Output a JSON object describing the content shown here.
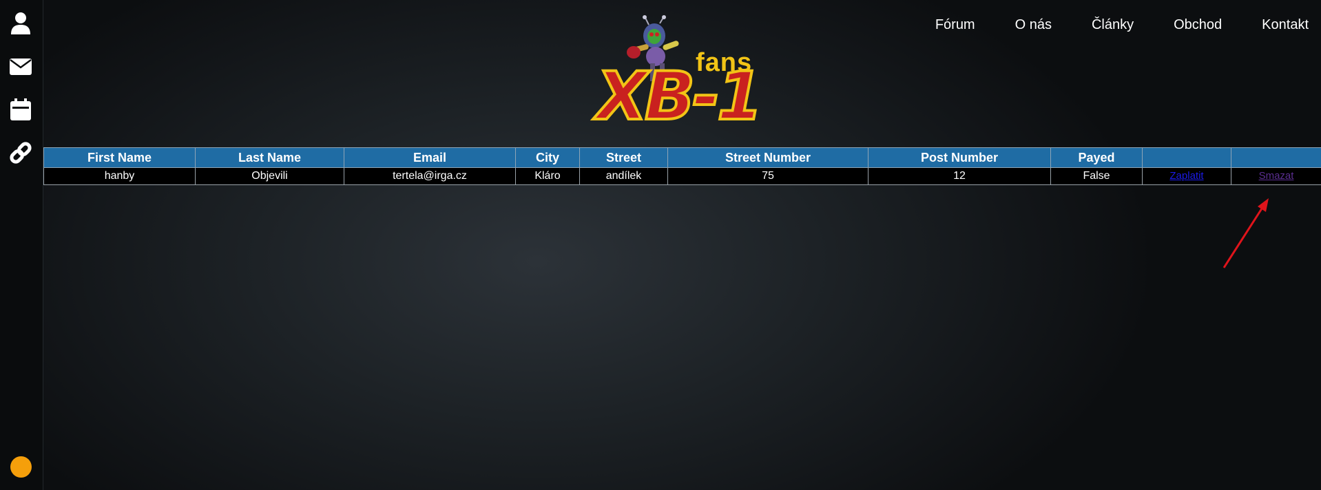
{
  "sidebar": {
    "items": [
      {
        "icon": "user-icon"
      },
      {
        "icon": "envelope-icon"
      },
      {
        "icon": "calendar-icon"
      },
      {
        "icon": "link-icon"
      }
    ],
    "status_color": "#f59f0b"
  },
  "logo": {
    "fans": "fans",
    "name": "XB-1"
  },
  "nav": {
    "items": [
      "Fórum",
      "O nás",
      "Články",
      "Obchod",
      "Kontakt"
    ]
  },
  "table": {
    "headers": [
      "First Name",
      "Last Name",
      "Email",
      "City",
      "Street",
      "Street Number",
      "Post Number",
      "Payed",
      "",
      ""
    ],
    "rows": [
      {
        "first_name": "hanby",
        "last_name": "Objevili",
        "email": "tertela@irga.cz",
        "city": "Kláro",
        "street": "andílek",
        "street_number": "75",
        "post_number": "12",
        "payed": "False",
        "pay_link": "Zaplatit",
        "delete_link": "Smazat"
      }
    ]
  },
  "colors": {
    "header_bg": "#1f6ca4",
    "annotation": "#e0141b"
  }
}
